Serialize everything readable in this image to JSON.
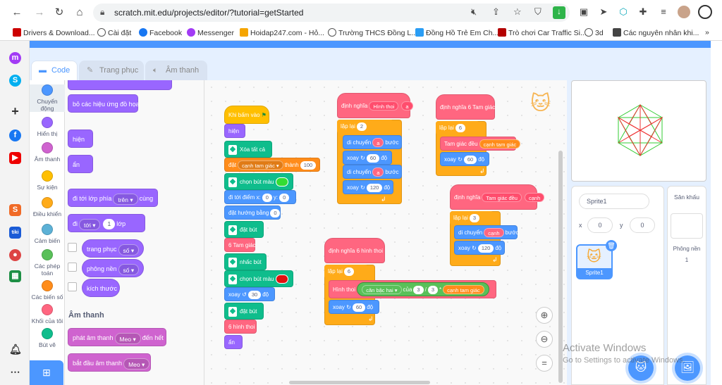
{
  "browser": {
    "url": "scratch.mit.edu/projects/editor/?tutorial=getStarted",
    "bookmarks": [
      "Drivers & Download...",
      "Cài đặt",
      "Facebook",
      "Messenger",
      "Hoidap247.com - Hỏ...",
      "Trường THCS Đồng L...",
      "Đồng Hồ Trẻ Em Ch...",
      "Trò chơi Car Traffic Si...",
      "3d",
      "Các nguyên nhân khi..."
    ],
    "more": "»"
  },
  "tabs": {
    "code": "Code",
    "costumes": "Trang phục",
    "sounds": "Âm thanh"
  },
  "categories": [
    {
      "label": "Chuyển động",
      "color": "#4c97ff"
    },
    {
      "label": "Hiển thị",
      "color": "#9966ff"
    },
    {
      "label": "Âm thanh",
      "color": "#cf63cf"
    },
    {
      "label": "Sự kiện",
      "color": "#ffbf00"
    },
    {
      "label": "Điều khiển",
      "color": "#ffab19"
    },
    {
      "label": "Cảm biến",
      "color": "#5cb1d6"
    },
    {
      "label": "Các phép toán",
      "color": "#59c059"
    },
    {
      "label": "Các biến số",
      "color": "#ff8c1a"
    },
    {
      "label": "Khối của tôi",
      "color": "#ff6680"
    },
    {
      "label": "Bút vẽ",
      "color": "#0fbd8c"
    }
  ],
  "palette": {
    "clear_effects": "bỏ các hiệu ứng đồ họa",
    "show": "hiện",
    "hide": "ẩn",
    "go_to_layer": "đi tới lớp phía",
    "go_layer_opt": "trên",
    "go_layer_suffix": "cùng",
    "go": "đi",
    "go_dir": "tới",
    "go_num": "1",
    "go_suffix": "lớp",
    "costume": "trang phục",
    "costume_opt": "số",
    "backdrop": "phông nền",
    "backdrop_opt": "số",
    "size": "kích thước",
    "sound_heading": "Âm thanh",
    "play_sound": "phát âm thanh",
    "sound_name": "Meo",
    "play_suffix": "đến hết",
    "start_sound": "bắt đầu âm thanh",
    "start_sound_name": "Meo"
  },
  "script1": {
    "when_flag": "Khi bấm vào",
    "show": "hiện",
    "clear": "Xóa tất cả",
    "set": "đặt",
    "var": "cạnh tam giác",
    "to": "thành",
    "val": "100",
    "pen_color": "chọn bút màu",
    "goto": "đi tới điểm x:",
    "x": "0",
    "y_label": "y:",
    "y": "0",
    "point_dir": "đặt hướng bằng",
    "dir": "0",
    "pen_down": "đặt bút",
    "triangles": "6 Tam giác",
    "pen_up": "nhấc bút",
    "pen_color2": "chọn bút màu",
    "turn": "xoay",
    "turn_val": "30",
    "deg": "độ",
    "pen_down2": "đặt bút",
    "hexagons": "6 hình thoi",
    "hide": "ẩn"
  },
  "script2": {
    "define": "định nghĩa",
    "name": "Hình thoi",
    "param": "a",
    "repeat": "lặp lại",
    "times": "2",
    "move": "di chuyển",
    "steps": "bước",
    "turn": "xoay",
    "t1": "60",
    "t2": "120",
    "deg": "độ"
  },
  "script3": {
    "define": "định nghĩa",
    "name": "6 Tam giác",
    "repeat": "lặp lại",
    "times": "6",
    "tri": "Tam giác đều",
    "tri_arg": "cạnh tam giác",
    "turn": "xoay",
    "t": "60",
    "deg": "độ"
  },
  "script4": {
    "define": "định nghĩa",
    "name": "Tam giác đều",
    "param": "cạnh",
    "repeat": "lặp lại",
    "times": "3",
    "move": "di chuyển",
    "steps": "bước",
    "turn": "xoay",
    "t": "120",
    "deg": "độ"
  },
  "script5": {
    "define": "định nghĩa",
    "name": "6 hình thoi",
    "repeat": "lặp lại",
    "times": "6",
    "rh": "Hình thoi",
    "sqrt": "căn bậc hai",
    "of": "của",
    "n1": "3",
    "div": "/",
    "n2": "3",
    "mul": "*",
    "var": "cạnh tam giác",
    "turn": "xoay",
    "t": "60",
    "deg": "độ"
  },
  "sprite": {
    "name": "Sprite1",
    "x_label": "x",
    "x": "0",
    "y_label": "y",
    "y": "0",
    "thumb_label": "Sprite1"
  },
  "stage_side": {
    "title": "Sân khấu",
    "backdrops_label": "Phông nền",
    "backdrops_count": "1"
  },
  "watermark": {
    "line1": "Activate Windows",
    "line2": "Go to Settings to activate Windows."
  },
  "colors": {
    "scratch_blue": "#4c97ff",
    "pen_color1": "#33dd33",
    "pen_color2": "#e01010"
  }
}
